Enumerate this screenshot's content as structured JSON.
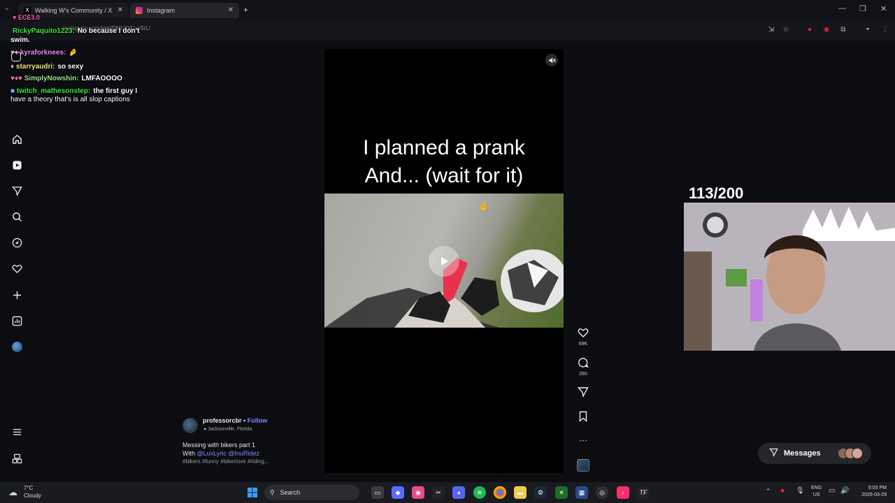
{
  "browser": {
    "tabs": [
      {
        "label": "Walking W's Community / X",
        "active": false
      },
      {
        "label": "Instagram",
        "active": true
      }
    ],
    "url": "instagram.com/reel/DMUOiFj-pSrL/",
    "new_tab_icon": "plus-icon"
  },
  "chat": {
    "messages": [
      {
        "user": "RickyPaquito1223:",
        "text": "No because I don't",
        "user_color": "#3ce83c"
      },
      {
        "user": "",
        "text": "swim.",
        "user_color": "#ffffff"
      },
      {
        "user": "kyraforknees:",
        "text": "",
        "user_color": "#e58cf0"
      },
      {
        "user": "starryaudri:",
        "text": "so sexy",
        "user_color": "#e7e77a"
      },
      {
        "user": "SimplyNowshin:",
        "text": "LMFAOOOO",
        "user_color": "#9be08a"
      },
      {
        "user": "twitch_mathesonstep:",
        "text": "the first guy I",
        "user_color": "#3ce83c"
      },
      {
        "user": "",
        "text": "have a theory that's is all slop captions",
        "user_color": "#ffffff"
      }
    ],
    "channel_name": "ECE3.0"
  },
  "sidebar": {
    "items": [
      {
        "icon": "home-icon"
      },
      {
        "icon": "reels-icon"
      },
      {
        "icon": "send-icon"
      },
      {
        "icon": "search-icon"
      },
      {
        "icon": "explore-icon"
      },
      {
        "icon": "heart-icon"
      },
      {
        "icon": "create-icon"
      },
      {
        "icon": "dashboard-icon"
      },
      {
        "icon": "profile-avatar"
      }
    ],
    "bottom": [
      {
        "icon": "menu-icon"
      },
      {
        "icon": "also-from-meta-icon"
      }
    ]
  },
  "reel": {
    "caption_line1": "I planned a prank",
    "caption_line2": "And... (wait for it)",
    "likes": "69K",
    "comments": "280",
    "muted": true
  },
  "post": {
    "username": "professorcbr",
    "follow_label": "Follow",
    "separator": "•",
    "location": "Jacksonville, Florida",
    "caption_line1": "Messing with bikers part 1",
    "with_label": "With",
    "mentions": "@LuxLyric @InuRidez",
    "hashtags": "#bikers #funny #bikerlove #riding..."
  },
  "overlay": {
    "counter": "113/200"
  },
  "messages_button": {
    "label": "Messages"
  },
  "taskbar": {
    "weather_temp": "7°C",
    "weather_desc": "Cloudy",
    "search_label": "Search",
    "lang_line1": "ENG",
    "lang_line2": "US",
    "time": "9:03 PM",
    "date": "2026-03-29"
  },
  "colors": {
    "accent_link": "#7a8cff",
    "instagram_bg": "#0c0d11"
  }
}
